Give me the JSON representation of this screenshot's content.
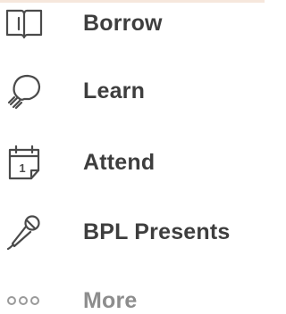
{
  "nav": {
    "items": [
      {
        "label": "Borrow",
        "icon": "book-icon"
      },
      {
        "label": "Learn",
        "icon": "lightbulb-icon"
      },
      {
        "label": "Attend",
        "icon": "calendar-icon",
        "icon_text": "1"
      },
      {
        "label": "BPL Presents",
        "icon": "microphone-icon"
      },
      {
        "label": "More",
        "icon": "more-icon"
      }
    ]
  },
  "colors": {
    "text": "#3e3e3e",
    "muted_text": "#8d8d8d",
    "icon_stroke": "#4a4a4a",
    "muted_icon": "#9a9a9a",
    "background": "#ffffff"
  }
}
